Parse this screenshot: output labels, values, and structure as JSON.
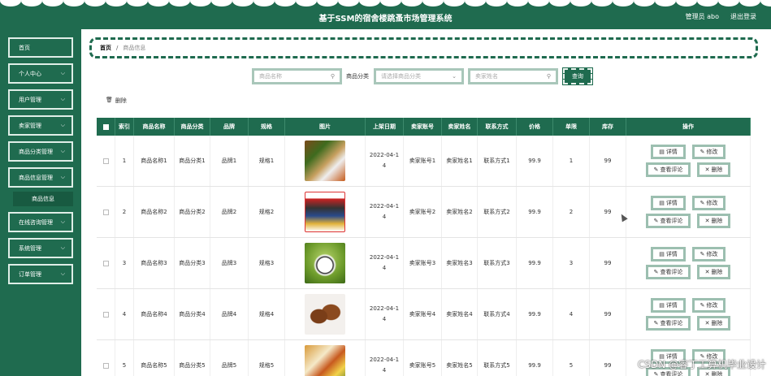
{
  "header": {
    "title": "基于SSM的宿舍楼跳蚤市场管理系统",
    "user": "管理员 abo",
    "logout": "退出登录"
  },
  "sidebar": {
    "items": [
      {
        "label": "首页",
        "has_chevron": false
      },
      {
        "label": "个人中心",
        "has_chevron": true
      },
      {
        "label": "用户管理",
        "has_chevron": true
      },
      {
        "label": "卖家管理",
        "has_chevron": true
      },
      {
        "label": "商品分类管理",
        "has_chevron": true
      },
      {
        "label": "商品信息管理",
        "has_chevron": true
      },
      {
        "label": "在线咨询管理",
        "has_chevron": true
      },
      {
        "label": "系统管理",
        "has_chevron": true
      },
      {
        "label": "订单管理",
        "has_chevron": true
      }
    ],
    "subitem": "商品信息"
  },
  "breadcrumb": {
    "home": "首页",
    "separator": "/",
    "current": "商品信息"
  },
  "search": {
    "name_placeholder": "商品名称",
    "category_label": "商品分类",
    "category_placeholder": "请选择商品分类",
    "seller_placeholder": "卖家姓名",
    "query_label": "查询"
  },
  "toolbar": {
    "delete_label": "删除"
  },
  "table": {
    "headers": [
      "索引",
      "商品名称",
      "商品分类",
      "品牌",
      "规格",
      "图片",
      "上架日期",
      "卖家账号",
      "卖家姓名",
      "联系方式",
      "价格",
      "单限",
      "库存",
      "操作"
    ],
    "rows": [
      {
        "index": "1",
        "name": "商品名称1",
        "category": "商品分类1",
        "brand": "品牌1",
        "spec": "规格1",
        "image": "food-box",
        "date_line1": "2022-04-1",
        "date_line2": "4",
        "seller_account": "卖家账号1",
        "seller_name": "卖家姓名1",
        "contact": "联系方式1",
        "price": "99.9",
        "limit": "1",
        "stock": "99"
      },
      {
        "index": "2",
        "name": "商品名称2",
        "category": "商品分类2",
        "brand": "品牌2",
        "spec": "规格2",
        "image": "snack-pack",
        "date_line1": "2022-04-1",
        "date_line2": "4",
        "seller_account": "卖家账号2",
        "seller_name": "卖家姓名2",
        "contact": "联系方式2",
        "price": "99.9",
        "limit": "2",
        "stock": "99"
      },
      {
        "index": "3",
        "name": "商品名称3",
        "category": "商品分类3",
        "brand": "品牌3",
        "spec": "规格3",
        "image": "soccer-ball",
        "date_line1": "2022-04-1",
        "date_line2": "4",
        "seller_account": "卖家账号3",
        "seller_name": "卖家姓名3",
        "contact": "联系方式3",
        "price": "99.9",
        "limit": "3",
        "stock": "99"
      },
      {
        "index": "4",
        "name": "商品名称4",
        "category": "商品分类4",
        "brand": "品牌4",
        "spec": "规格4",
        "image": "leather-shoes",
        "date_line1": "2022-04-1",
        "date_line2": "4",
        "seller_account": "卖家账号4",
        "seller_name": "卖家姓名4",
        "contact": "联系方式4",
        "price": "99.9",
        "limit": "4",
        "stock": "99"
      },
      {
        "index": "5",
        "name": "商品名称5",
        "category": "商品分类5",
        "brand": "品牌5",
        "spec": "规格5",
        "image": "meal-box",
        "date_line1": "2022-04-1",
        "date_line2": "4",
        "seller_account": "卖家账号5",
        "seller_name": "卖家姓名5",
        "contact": "联系方式5",
        "price": "99.9",
        "limit": "5",
        "stock": "99"
      }
    ],
    "actions": {
      "detail": "详情",
      "edit": "修改",
      "review": "查看评论",
      "delete": "删除"
    }
  },
  "watermark": "CSDN @睿丁工算机毕业设计",
  "colors": {
    "primary": "#1f6b4f",
    "button_border": "#9cbfb0"
  }
}
